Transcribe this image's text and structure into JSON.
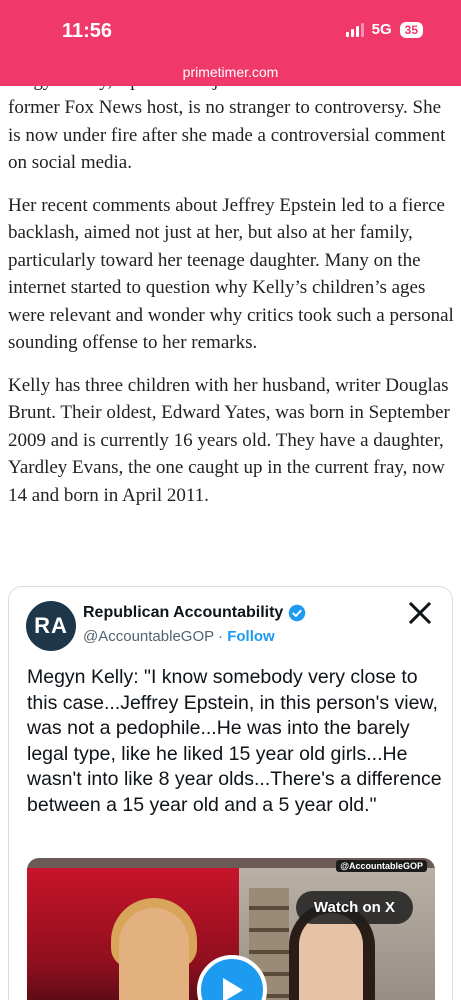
{
  "status_bar": {
    "time": "11:56",
    "network": "5G",
    "battery": "35",
    "url": "primetimer.com",
    "background_color": "#f0386b"
  },
  "article": {
    "clipped_line": "Megyn Kelly, a prominent journalist and former",
    "paragraphs": [
      "former Fox News host, is no stranger to controversy. She is now under fire after she made a controversial comment on social media.",
      "Her recent comments about Jeffrey Epstein led to a fierce backlash, aimed not just at her, but also at her family, particularly toward her teenage daughter. Many on the internet started to question why Kelly’s children’s ages were relevant and wonder why critics took such a personal sounding offense to her remarks.",
      "Kelly has three children with her husband, writer Douglas Brunt. Their oldest, Edward Yates, was born in September 2009 and is currently 16 years old. They have a daughter, Yardley Evans, the one caught up in the current fray, now 14 and born in April 2011."
    ]
  },
  "tweet": {
    "avatar_text": "RA",
    "name": "Republican Accountability",
    "handle": "@AccountableGOP",
    "separator": " · ",
    "follow_label": "Follow",
    "text": "Megyn Kelly: \"I know somebody very close to this case...Jeffrey Epstein, in this person's view, was not a pedophile...He was into the barely legal type, like he liked 15 year old girls...He wasn't into like 8 year olds...There's a difference between a 15 year old and a 5 year old.\"",
    "media": {
      "handle_overlay": "@AccountableGOP",
      "watch_label": "Watch on X"
    },
    "accent_color": "#1d9bf0",
    "icons": [
      "verified-badge-icon",
      "x-logo-icon",
      "play-icon"
    ]
  }
}
